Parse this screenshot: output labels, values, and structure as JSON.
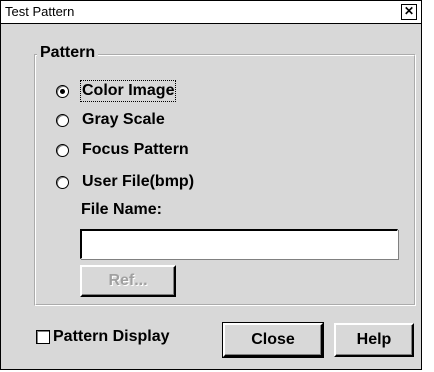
{
  "window": {
    "title": "Test Pattern",
    "close_glyph": "✕"
  },
  "pattern_group": {
    "label": "Pattern",
    "options": [
      {
        "label": "Color Image",
        "selected": true
      },
      {
        "label": "Gray Scale",
        "selected": false
      },
      {
        "label": "Focus Pattern",
        "selected": false
      },
      {
        "label": "User File(bmp)",
        "selected": false
      }
    ],
    "file_name_label": "File Name:",
    "file_name_value": "",
    "ref_button": "Ref..."
  },
  "footer": {
    "pattern_display_label": "Pattern Display",
    "pattern_display_checked": false,
    "close_button": "Close",
    "help_button": "Help"
  }
}
